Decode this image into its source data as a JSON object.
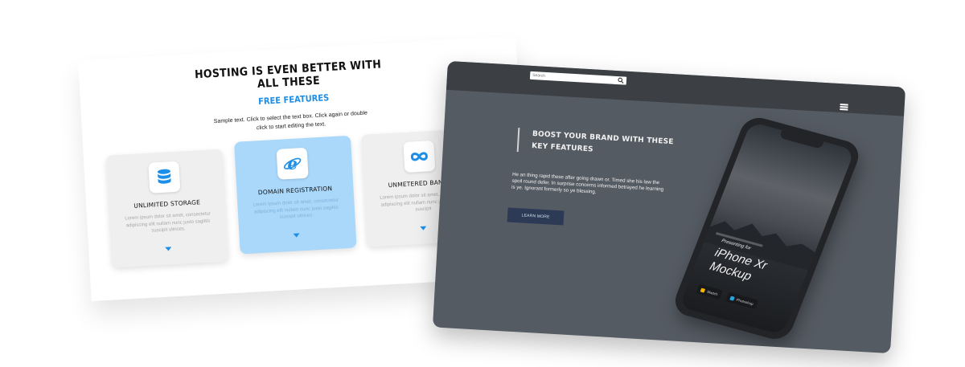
{
  "left_page": {
    "title": "HOSTING IS EVEN BETTER WITH ALL THESE",
    "subtitle": "FREE FEATURES",
    "description": "Sample text. Click to select the text box. Click again or double click to start editing the text.",
    "cards": [
      {
        "icon": "database-icon",
        "title": "UNLIMITED STORAGE",
        "text": "Lorem ipsum dolor sit amet, consectetur adipiscing elit nullam nunc justo sagittis suscipit ultrices.",
        "active": false
      },
      {
        "icon": "internet-explorer-icon",
        "title": "DOMAIN REGISTRATION",
        "text": "Lorem ipsum dolor sit amet, consectetur adipiscing elit nullam nunc justo sagittis suscipit ultrices.",
        "active": true
      },
      {
        "icon": "infinity-icon",
        "title": "UNMETERED BANDWI",
        "text": "Lorem ipsum dolor sit amet, consectetur adipiscing elit nullam nunc justo sagittis suscipit",
        "active": false
      }
    ]
  },
  "right_page": {
    "search_placeholder": "Search",
    "heading": "BOOST YOUR BRAND WITH THESE KEY FEATURES",
    "body": "He an thing rapid these after going drawn or. Timed she his law the spoil round defer. In surprise concerns informed betrayed he learning is ye. Ignorant formerly so ye blessing.",
    "button_label": "LEARN MORE",
    "phone": {
      "presenting": "Presenting for",
      "model_line1": "iPhone Xr",
      "model_line2": "Mockup",
      "badges": [
        "Sketch",
        "Photoshop"
      ]
    }
  },
  "colors": {
    "accent_blue": "#1e8fe8",
    "active_card": "#aad8fb",
    "dark_bg": "#555b63",
    "topbar": "#3c3f44",
    "button": "#2c3a55"
  }
}
